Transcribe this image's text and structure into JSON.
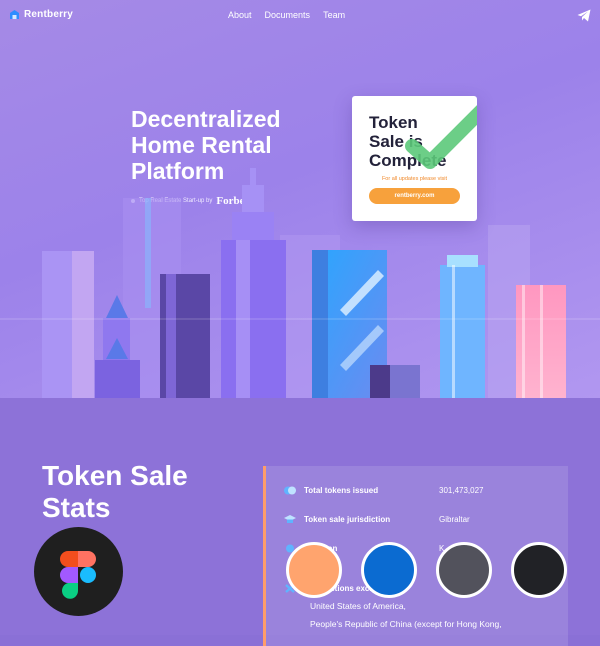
{
  "nav": {
    "brand": "Rentberry",
    "links": [
      "About",
      "Documents",
      "Team"
    ]
  },
  "hero": {
    "headline_lines": [
      "Decentralized",
      "Home Rental",
      "Platform"
    ],
    "tagline": "Top Real Estate Start-up by",
    "tagline_brand": "Forbes"
  },
  "card": {
    "title_lines": [
      "Token",
      "Sale is",
      "Complete"
    ],
    "note": "For all updates please visit",
    "button": "rentberry.com"
  },
  "stats": {
    "title_lines": [
      "Token Sale",
      "Stats"
    ],
    "rows": [
      {
        "label": "Total tokens issued",
        "value": "301,473,027"
      },
      {
        "label": "Token sale jurisdiction",
        "value": "Gibraltar"
      },
      {
        "label": "Location",
        "value": "K"
      },
      {
        "label": "Jurisdictions excluded",
        "value": ""
      }
    ],
    "excluded": [
      "United States of America,",
      "People's Republic of China (except for Hong Kong,"
    ]
  },
  "colors": {
    "accent_orange": "#f7a13c",
    "checkmark_green": "#5cc97a",
    "swatches": [
      "#ffa46e",
      "#0b6bd1",
      "#52525c",
      "#212226"
    ]
  },
  "icons": [
    "rentberry-logo-icon",
    "telegram-icon",
    "checkmark-icon",
    "figma-icon"
  ]
}
